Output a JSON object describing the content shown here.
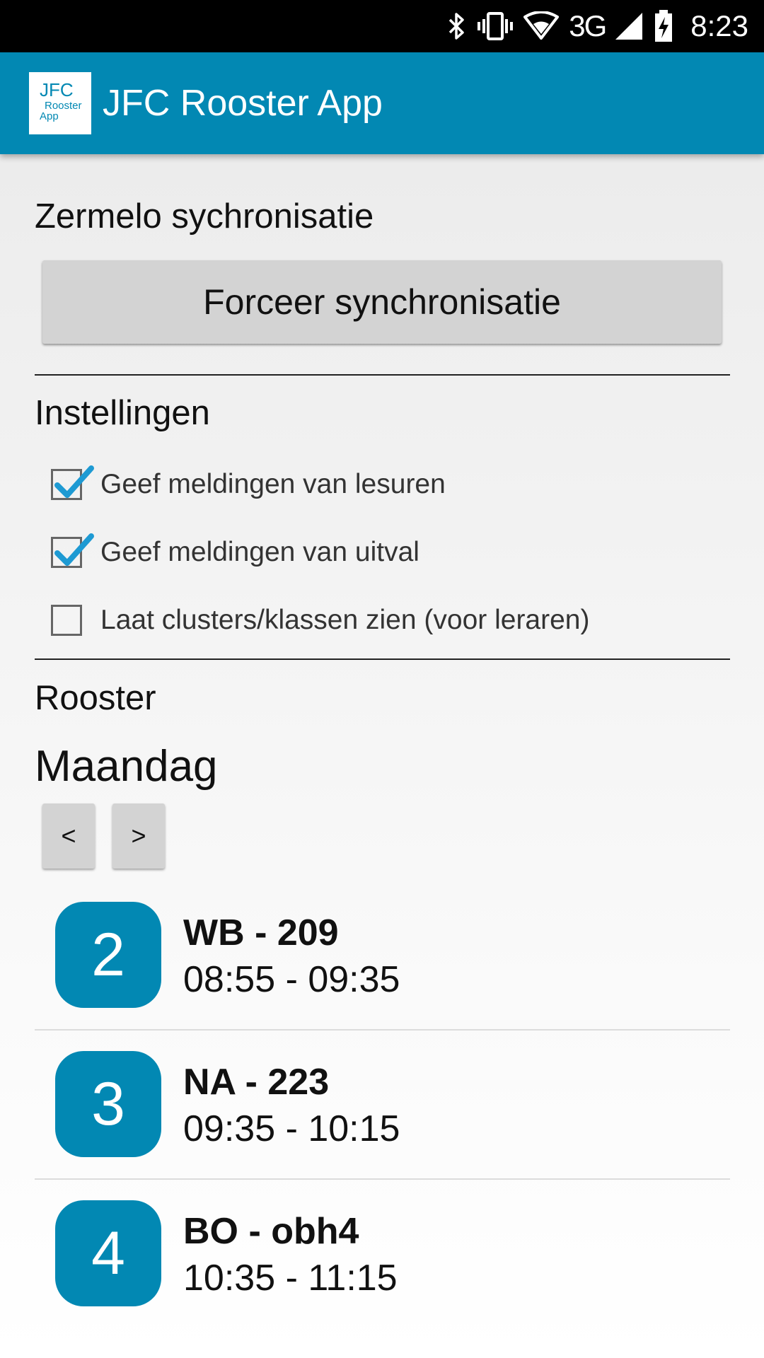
{
  "status_bar": {
    "time": "8:23",
    "network": "3G",
    "icons": [
      "bluetooth-icon",
      "vibrate-icon",
      "wifi-icon",
      "signal-icon",
      "battery-charging-icon"
    ]
  },
  "app_bar": {
    "logo": {
      "line1": "JFC",
      "line2": "Rooster",
      "line3": "App"
    },
    "title": "JFC Rooster App"
  },
  "sync": {
    "heading": "Zermelo sychronisatie",
    "button_label": "Forceer synchronisatie"
  },
  "settings": {
    "heading": "Instellingen",
    "options": [
      {
        "label": "Geef meldingen van lesuren",
        "checked": true
      },
      {
        "label": "Geef meldingen van uitval",
        "checked": true
      },
      {
        "label": "Laat clusters/klassen zien (voor leraren)",
        "checked": false
      }
    ]
  },
  "schedule": {
    "heading": "Rooster",
    "day": "Maandag",
    "prev_label": "<",
    "next_label": ">",
    "lessons": [
      {
        "hour": "2",
        "subject": "WB - 209",
        "time": "08:55 - 09:35"
      },
      {
        "hour": "3",
        "subject": "NA - 223",
        "time": "09:35 - 10:15"
      },
      {
        "hour": "4",
        "subject": "BO - obh4",
        "time": "10:35 - 11:15"
      }
    ]
  },
  "colors": {
    "accent": "#0288b3",
    "status_bar": "#000000",
    "button": "#d3d3d3"
  }
}
